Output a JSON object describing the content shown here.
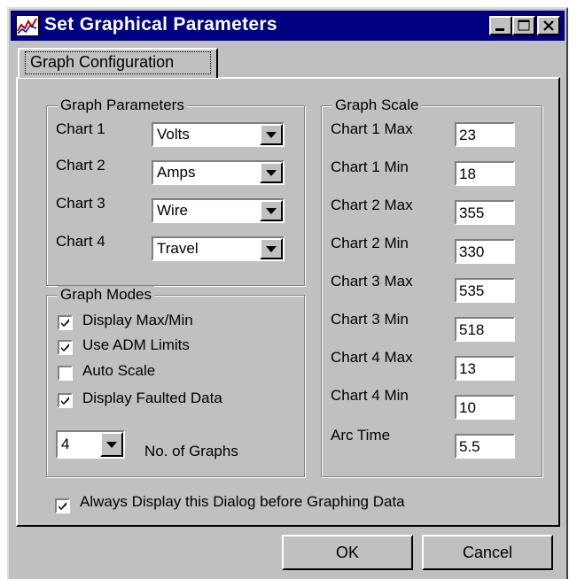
{
  "window": {
    "title": "Set Graphical Parameters",
    "icon": "chart-icon",
    "controls": [
      "minimize-icon",
      "maximize-icon",
      "close-icon"
    ]
  },
  "tabs": [
    {
      "label": "Graph Configuration",
      "selected": true
    }
  ],
  "graph_parameters": {
    "title": "Graph Parameters",
    "rows": [
      {
        "label": "Chart 1",
        "value": "Volts"
      },
      {
        "label": "Chart 2",
        "value": "Amps"
      },
      {
        "label": "Chart 3",
        "value": "Wire"
      },
      {
        "label": "Chart 4",
        "value": "Travel"
      }
    ]
  },
  "graph_modes": {
    "title": "Graph Modes",
    "options": [
      {
        "label": "Display Max/Min",
        "checked": true
      },
      {
        "label": "Use ADM Limits",
        "checked": true
      },
      {
        "label": "Auto Scale",
        "checked": false
      },
      {
        "label": "Display Faulted Data",
        "checked": true
      }
    ],
    "num_graphs": {
      "value": "4",
      "label": "No. of Graphs"
    }
  },
  "graph_scale": {
    "title": "Graph Scale",
    "rows": [
      {
        "label": "Chart 1 Max",
        "value": "23"
      },
      {
        "label": "Chart 1 Min",
        "value": "18"
      },
      {
        "label": "Chart 2 Max",
        "value": "355"
      },
      {
        "label": "Chart 2 Min",
        "value": "330"
      },
      {
        "label": "Chart 3 Max",
        "value": "535"
      },
      {
        "label": "Chart 3 Min",
        "value": "518"
      },
      {
        "label": "Chart 4 Max",
        "value": "13"
      },
      {
        "label": "Chart 4 Min",
        "value": "10"
      },
      {
        "label": "Arc Time",
        "value": "5.5"
      }
    ]
  },
  "always_display": {
    "label": "Always Display this Dialog before Graphing Data",
    "checked": true
  },
  "buttons": {
    "ok": "OK",
    "cancel": "Cancel"
  },
  "colors": {
    "titlebar": "#000080",
    "face": "#c0c0c0"
  }
}
